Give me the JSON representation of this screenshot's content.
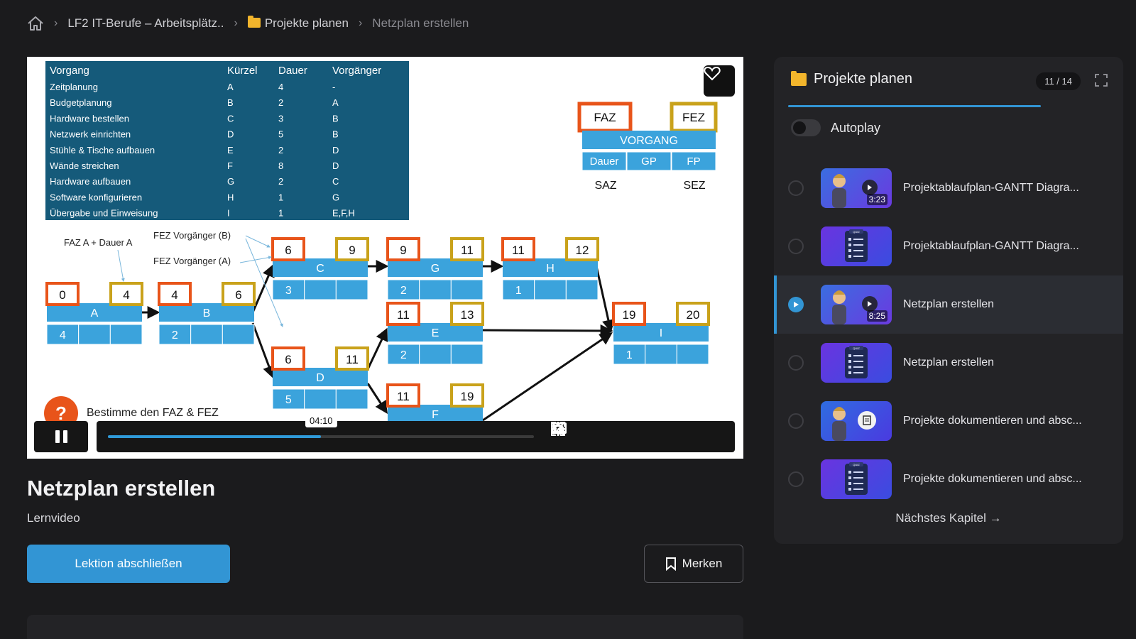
{
  "breadcrumb": {
    "home_icon": "home-icon",
    "items": [
      "LF2 IT-Berufe – Arbeitsplätz..",
      "Projekte planen",
      "Netzplan erstellen"
    ]
  },
  "video": {
    "table": {
      "headers": [
        "Vorgang",
        "Kürzel",
        "Dauer",
        "Vorgänger"
      ],
      "rows": [
        [
          "Zeitplanung",
          "A",
          "4",
          "-"
        ],
        [
          "Budgetplanung",
          "B",
          "2",
          "A"
        ],
        [
          "Hardware bestellen",
          "C",
          "3",
          "B"
        ],
        [
          "Netzwerk einrichten",
          "D",
          "5",
          "B"
        ],
        [
          "Stühle & Tische aufbauen",
          "E",
          "2",
          "D"
        ],
        [
          "Wände streichen",
          "F",
          "8",
          "D"
        ],
        [
          "Hardware aufbauen",
          "G",
          "2",
          "C"
        ],
        [
          "Software konfigurieren",
          "H",
          "1",
          "G"
        ],
        [
          "Übergabe und Einweisung",
          "I",
          "1",
          "E,F,H"
        ]
      ]
    },
    "legend": {
      "faz": "FAZ",
      "fez": "FEZ",
      "vorgang": "VORGANG",
      "dauer": "Dauer",
      "gp": "GP",
      "fp": "FP",
      "saz": "SAZ",
      "sez": "SEZ"
    },
    "annotations": [
      "FAZ A + Dauer A",
      "FEZ Vorgänger (B)",
      "FEZ Vorgänger (A)"
    ],
    "nodes": [
      {
        "id": "A",
        "faz": "0",
        "fez": "4",
        "dauer": "4"
      },
      {
        "id": "B",
        "faz": "4",
        "fez": "6",
        "dauer": "2"
      },
      {
        "id": "C",
        "faz": "6",
        "fez": "9",
        "dauer": "3"
      },
      {
        "id": "D",
        "faz": "6",
        "fez": "11",
        "dauer": "5"
      },
      {
        "id": "G",
        "faz": "9",
        "fez": "11",
        "dauer": "2"
      },
      {
        "id": "H",
        "faz": "11",
        "fez": "12",
        "dauer": "1"
      },
      {
        "id": "E",
        "faz": "11",
        "fez": "13",
        "dauer": "2"
      },
      {
        "id": "F",
        "faz": "11",
        "fez": "19",
        "dauer": ""
      },
      {
        "id": "I",
        "faz": "19",
        "fez": "20",
        "dauer": "1"
      }
    ],
    "task_text": "Bestimme den FAZ & FEZ",
    "task_badge": "?",
    "time_tooltip": "04:10",
    "progress": 0.5,
    "colors": {
      "blue": "#3ba3dc",
      "orange": "#e8541a",
      "gold": "#c9a21b",
      "table_bg": "#155a7a"
    }
  },
  "lesson": {
    "title": "Netzplan erstellen",
    "type": "Lernvideo",
    "complete_label": "Lektion abschließen",
    "bookmark_label": "Merken"
  },
  "panel": {
    "title": "Projekte planen",
    "counter": "11 / 14",
    "autoplay_label": "Autoplay",
    "items": [
      {
        "label": "Projektablaufplan-GANTT Diagra...",
        "kind": "video",
        "duration": "3:23"
      },
      {
        "label": "Projektablaufplan-GANTT Diagra...",
        "kind": "quiz",
        "duration": ""
      },
      {
        "label": "Netzplan erstellen",
        "kind": "video",
        "duration": "8:25"
      },
      {
        "label": "Netzplan erstellen",
        "kind": "quiz",
        "duration": ""
      },
      {
        "label": "Projekte dokumentieren und absc...",
        "kind": "doc",
        "duration": ""
      },
      {
        "label": "Projekte dokumentieren und absc...",
        "kind": "quiz",
        "duration": ""
      }
    ],
    "next_label": "Nächstes Kapitel",
    "accent": "#3295d4"
  }
}
